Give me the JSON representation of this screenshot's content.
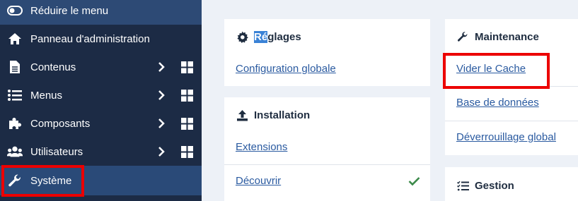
{
  "sidebar": {
    "collapse_label": "Réduire le menu",
    "items": [
      {
        "label": "Panneau d'administration",
        "icon": "home-icon"
      },
      {
        "label": "Contenus",
        "icon": "file-icon"
      },
      {
        "label": "Menus",
        "icon": "list-icon"
      },
      {
        "label": "Composants",
        "icon": "puzzle-icon"
      },
      {
        "label": "Utilisateurs",
        "icon": "users-icon"
      },
      {
        "label": "Système",
        "icon": "wrench-icon"
      }
    ]
  },
  "cards": {
    "reglages": {
      "title_selected": "Ré",
      "title_rest": "glages",
      "links": [
        "Configuration globale"
      ]
    },
    "installation": {
      "title": "Installation",
      "links": [
        "Extensions",
        "Découvrir"
      ]
    },
    "maintenance": {
      "title": "Maintenance",
      "links": [
        "Vider le Cache",
        "Base de données",
        "Déverrouillage global"
      ]
    },
    "gestion": {
      "title": "Gestion"
    }
  },
  "colors": {
    "sidebar_bg": "#1c2b45",
    "active_bg": "#2a4a78",
    "link": "#2a5aa0",
    "highlight": "#ec0000",
    "check": "#3c8a4a"
  }
}
